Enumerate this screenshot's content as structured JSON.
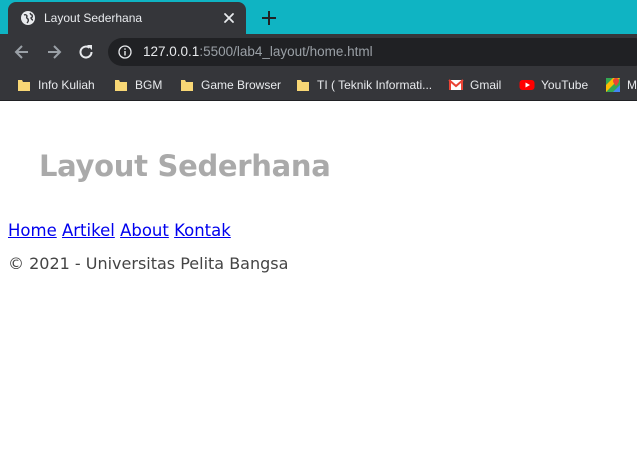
{
  "browser": {
    "tab_title": "Layout Sederhana",
    "url_host": "127.0.0.1",
    "url_rest": ":5500/lab4_layout/home.html",
    "bookmarks": [
      {
        "label": "Info Kuliah",
        "icon": "folder-icon"
      },
      {
        "label": "BGM",
        "icon": "folder-icon"
      },
      {
        "label": "Game Browser",
        "icon": "folder-icon"
      },
      {
        "label": "TI ( Teknik Informati...",
        "icon": "folder-icon"
      },
      {
        "label": "Gmail",
        "icon": "gmail-icon"
      },
      {
        "label": "YouTube",
        "icon": "youtube-icon"
      },
      {
        "label": "M",
        "icon": "maps-icon"
      }
    ],
    "colors": {
      "tabstrip": "#0fb4c3",
      "toolbar": "#35363a",
      "omnibox": "#202124"
    }
  },
  "page": {
    "title": "Layout Sederhana",
    "nav": [
      "Home",
      "Artikel",
      "About",
      "Kontak"
    ],
    "footer": "© 2021 - Universitas Pelita Bangsa",
    "colors": {
      "title": "#aaaaaa",
      "link": "#0000ee",
      "footer_text": "#444444"
    }
  }
}
